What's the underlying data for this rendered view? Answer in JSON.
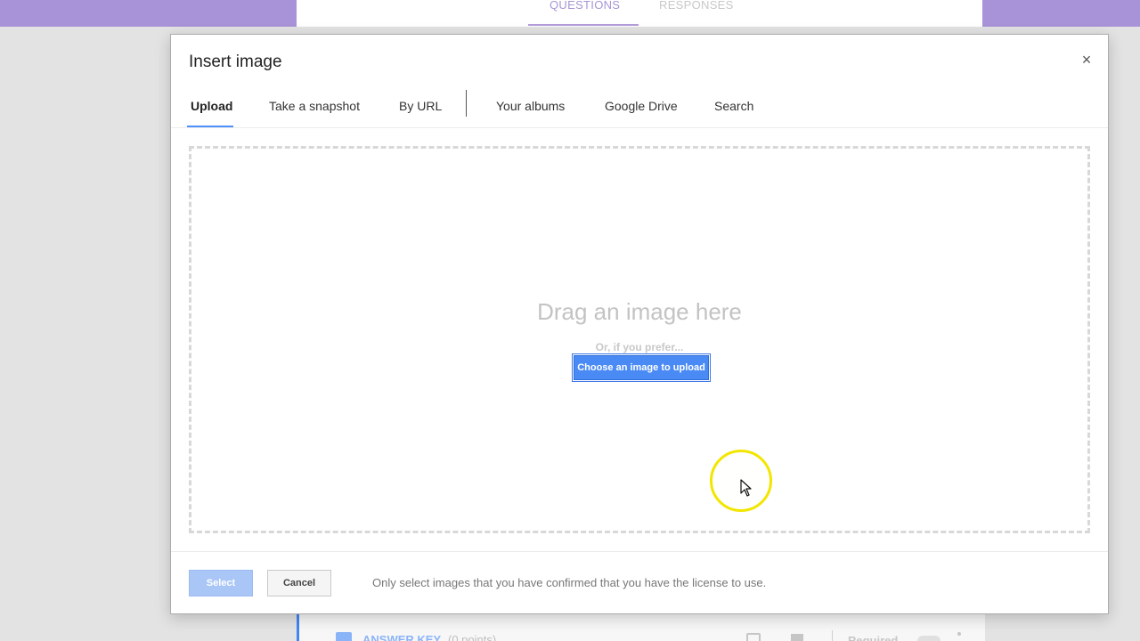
{
  "form": {
    "tabs": [
      "QUESTIONS",
      "RESPONSES"
    ],
    "answer_key_label": "ANSWER KEY",
    "answer_key_points": "(0 points)",
    "required_label": "Required"
  },
  "dialog": {
    "title": "Insert image",
    "close_symbol": "×",
    "tabs": [
      {
        "label": "Upload",
        "active": true
      },
      {
        "label": "Take a snapshot",
        "active": false
      },
      {
        "label": "By URL",
        "active": false
      },
      {
        "label": "Your albums",
        "active": false
      },
      {
        "label": "Google Drive",
        "active": false
      },
      {
        "label": "Search",
        "active": false
      }
    ],
    "drop_zone": {
      "title": "Drag an image here",
      "or_text": "Or, if you prefer...",
      "choose_button": "Choose an image to upload"
    },
    "footer": {
      "select_button": "Select",
      "cancel_button": "Cancel",
      "license_note": "Only select images that you have confirmed that you have the license to use."
    }
  },
  "colors": {
    "accent": "#4a8af4",
    "header_purple": "#a993d8",
    "cursor_highlight": "#f2e600"
  },
  "icons": {
    "close": "close-icon",
    "cursor": "mouse-pointer-icon"
  }
}
